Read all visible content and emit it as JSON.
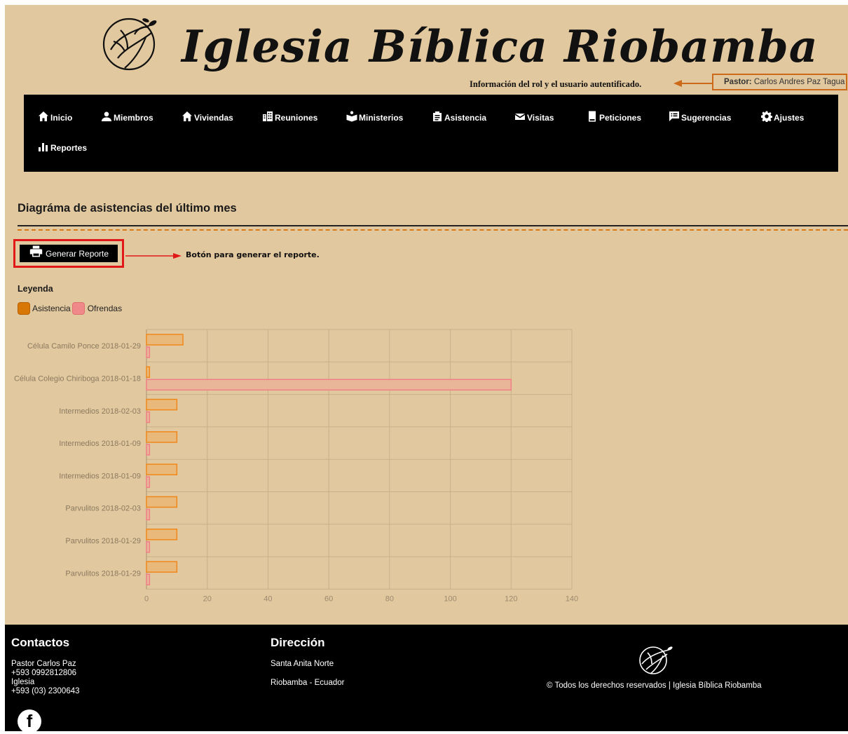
{
  "header": {
    "site_title": "Iglesia Bíblica Riobamba",
    "annotation_user": "Información del rol y el usuario autentificado.",
    "user_role": "Pastor:",
    "user_name": "Carlos Andres Paz Tagua"
  },
  "nav": {
    "items": [
      {
        "label": "Inicio",
        "icon": "home-icon"
      },
      {
        "label": "Miembros",
        "icon": "user-icon"
      },
      {
        "label": "Viviendas",
        "icon": "home-icon"
      },
      {
        "label": "Reuniones",
        "icon": "buildings-icon"
      },
      {
        "label": "Ministerios",
        "icon": "ministry-icon"
      },
      {
        "label": "Asistencia",
        "icon": "clipboard-icon"
      },
      {
        "label": "Visitas",
        "icon": "inbox-icon"
      },
      {
        "label": "Peticiones",
        "icon": "book-icon"
      },
      {
        "label": "Sugerencias",
        "icon": "chat-list-icon"
      },
      {
        "label": "Ajustes",
        "icon": "gear-icon"
      },
      {
        "label": "Reportes",
        "icon": "bar-chart-icon"
      }
    ]
  },
  "main": {
    "title": "Diagráma de asistencias del último mes",
    "report_button_label": "Generar Reporte",
    "annotation_button": "Botón para generar el reporte.",
    "legend_title": "Leyenda"
  },
  "colors": {
    "background": "#e2c89e",
    "asistencia": "#d97706",
    "ofrendas": "#f08a8a",
    "nav_bg": "#000000",
    "annotation_box": "#cc6a1a",
    "annotation_red": "#e01818"
  },
  "chart_data": {
    "type": "bar",
    "orientation": "horizontal",
    "categories": [
      "Célula Camilo Ponce 2018-01-29",
      "Célula Colegio Chiriboga 2018-01-18",
      "Intermedios 2018-02-03",
      "Intermedios 2018-01-09",
      "Intermedios 2018-01-09",
      "Parvulitos 2018-02-03",
      "Parvulitos 2018-01-29",
      "Parvulitos 2018-01-29"
    ],
    "series": [
      {
        "name": "Asistencia",
        "values": [
          12,
          1,
          10,
          10,
          10,
          10,
          10,
          10
        ]
      },
      {
        "name": "Ofrendas",
        "values": [
          1,
          120,
          1,
          1,
          1,
          1,
          1,
          1
        ]
      }
    ],
    "xlim": [
      0,
      140
    ],
    "xticks": [
      "0",
      "20",
      "40",
      "60",
      "80",
      "100",
      "120",
      "140"
    ],
    "grid": true,
    "legend": "top-left"
  },
  "footer": {
    "contacts_title": "Contactos",
    "contact_lines": [
      "Pastor Carlos Paz",
      "+593 0992812806",
      "Iglesia",
      "+593 (03) 2300643"
    ],
    "address_title": "Dirección",
    "address_lines": [
      "Santa Anita Norte",
      "Riobamba - Ecuador"
    ],
    "copyright": "© Todos los derechos reservados | Iglesia Bíblica Riobamba",
    "facebook_icon": "facebook-icon"
  }
}
